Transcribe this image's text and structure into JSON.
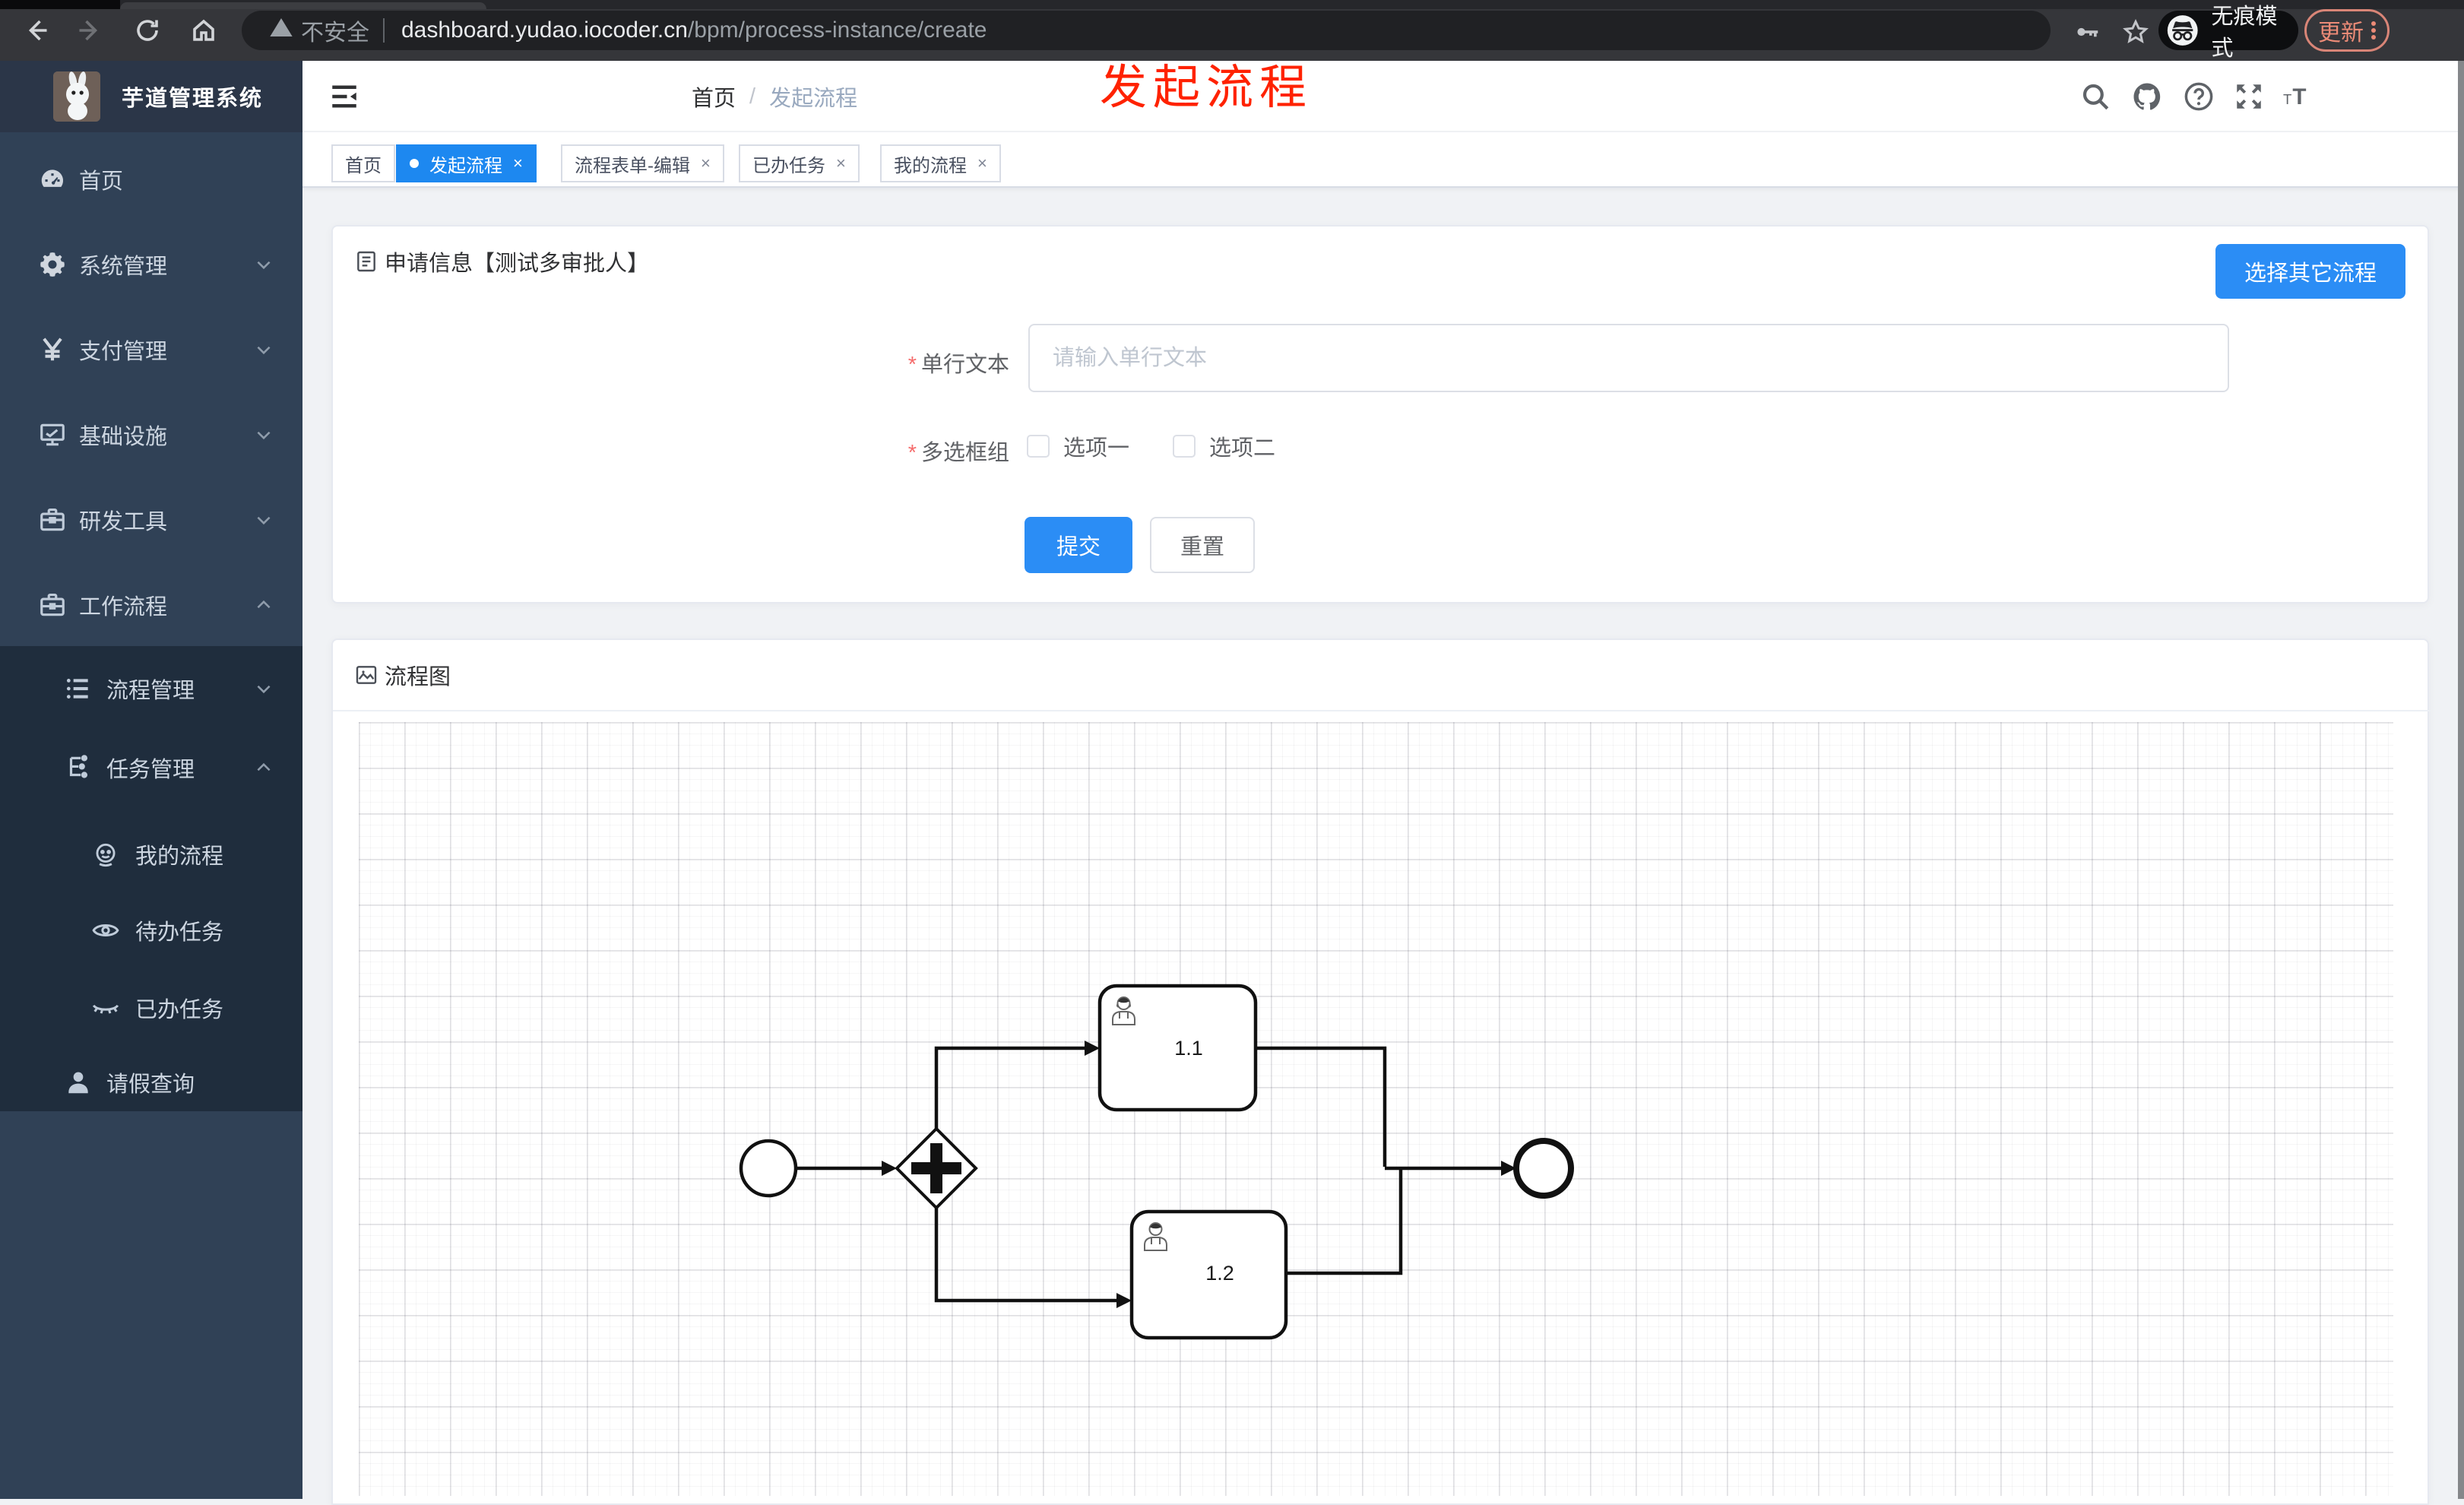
{
  "browser": {
    "not_secure": "不安全",
    "domain": "dashboard.yudao.iocoder.cn",
    "path": "/bpm/process-instance/create",
    "incognito": "无痕模式",
    "update": "更新"
  },
  "overlay": {
    "title": "发起流程"
  },
  "sidebar": {
    "title": "芋道管理系统",
    "items": [
      {
        "label": "首页"
      },
      {
        "label": "系统管理"
      },
      {
        "label": "支付管理"
      },
      {
        "label": "基础设施"
      },
      {
        "label": "研发工具"
      },
      {
        "label": "工作流程"
      }
    ],
    "submenu": [
      {
        "label": "流程管理"
      },
      {
        "label": "任务管理"
      }
    ],
    "sub_items": [
      {
        "label": "我的流程"
      },
      {
        "label": "待办任务"
      },
      {
        "label": "已办任务"
      }
    ],
    "leave": {
      "label": "请假查询"
    }
  },
  "breadcrumb": {
    "home": "首页",
    "current": "发起流程"
  },
  "tabs": [
    {
      "label": "首页"
    },
    {
      "label": "发起流程"
    },
    {
      "label": "流程表单-编辑"
    },
    {
      "label": "已办任务"
    },
    {
      "label": "我的流程"
    }
  ],
  "tab_close": "×",
  "cards": {
    "form": {
      "title": "申请信息【测试多审批人】",
      "other_button": "选择其它流程"
    },
    "diagram": {
      "title": "流程图"
    }
  },
  "form": {
    "fields": [
      {
        "label": "单行文本",
        "placeholder": "请输入单行文本"
      },
      {
        "label": "多选框组",
        "options": [
          "选项一",
          "选项二"
        ]
      }
    ],
    "submit": "提交",
    "reset": "重置"
  },
  "diagram": {
    "type": "bpmn",
    "tasks": [
      {
        "label": "1.1"
      },
      {
        "label": "1.2"
      }
    ],
    "structure": "start → parallel-gateway → (user-task 1.1 | user-task 1.2) → end"
  },
  "colors": {
    "accent_blue": "#2b8df5",
    "tab_active_blue": "#1d88f0",
    "overlay_red": "#ff2200",
    "sidebar_bg": "#304156",
    "submenu_bg": "#1f2d3d"
  }
}
